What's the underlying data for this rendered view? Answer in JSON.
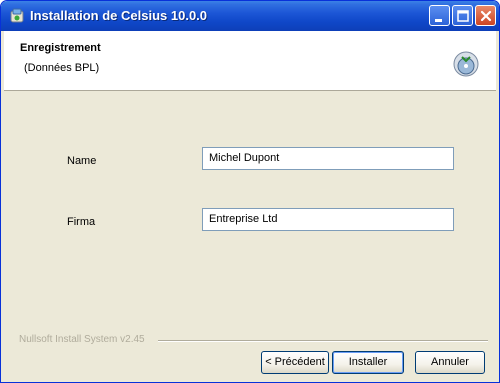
{
  "window": {
    "title": "Installation de Celsius 10.0.0"
  },
  "header": {
    "title": "Enregistrement",
    "subtitle": "(Données BPL)"
  },
  "form": {
    "name_label": "Name",
    "name_value": "Michel Dupont",
    "firma_label": "Firma",
    "firma_value": "Entreprise Ltd"
  },
  "footer": {
    "branding": "Nullsoft Install System v2.45",
    "prev_label": "< Précédent",
    "install_label": "Installer",
    "cancel_label": "Annuler"
  },
  "colors": {
    "titlebar": "#0f47c8",
    "face": "#ece9d8",
    "close_button": "#cc4422"
  },
  "icons": {
    "title": "installer-app-icon",
    "header": "setup-disk-icon",
    "minimize": "minimize-icon",
    "maximize": "maximize-icon",
    "close": "close-icon"
  }
}
